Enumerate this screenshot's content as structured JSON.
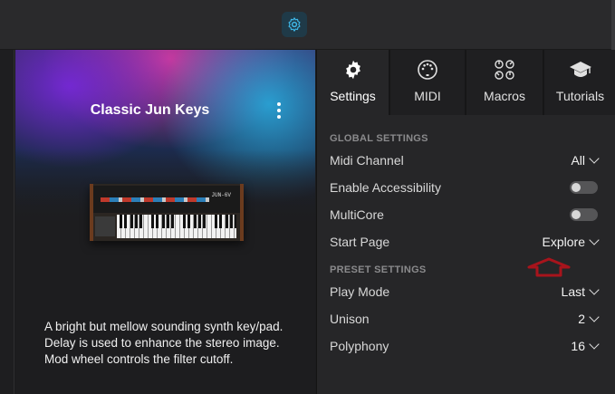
{
  "topbar": {
    "icon": "gear-icon",
    "accent": "#3fb7e6"
  },
  "preset": {
    "title": "Classic Jun Keys",
    "description": "A bright but mellow sounding synth key/pad. Delay is used to enhance the stereo image. Mod wheel controls the filter cutoff.",
    "instrument_label": "JUN-6V"
  },
  "tabs": [
    {
      "label": "Settings",
      "icon": "gear-icon"
    },
    {
      "label": "MIDI",
      "icon": "midi-port-icon"
    },
    {
      "label": "Macros",
      "icon": "knobs-icon"
    },
    {
      "label": "Tutorials",
      "icon": "graduation-cap-icon"
    }
  ],
  "global_settings": {
    "title": "GLOBAL SETTINGS",
    "midi_channel": {
      "label": "Midi Channel",
      "value": "All"
    },
    "accessibility": {
      "label": "Enable Accessibility",
      "on": false
    },
    "multicore": {
      "label": "MultiCore",
      "on": false
    },
    "start_page": {
      "label": "Start Page",
      "value": "Explore"
    }
  },
  "preset_settings": {
    "title": "PRESET SETTINGS",
    "play_mode": {
      "label": "Play Mode",
      "value": "Last"
    },
    "unison": {
      "label": "Unison",
      "value": "2"
    },
    "polyphony": {
      "label": "Polyphony",
      "value": "16"
    }
  },
  "colors": {
    "marker": "#a8141c"
  }
}
